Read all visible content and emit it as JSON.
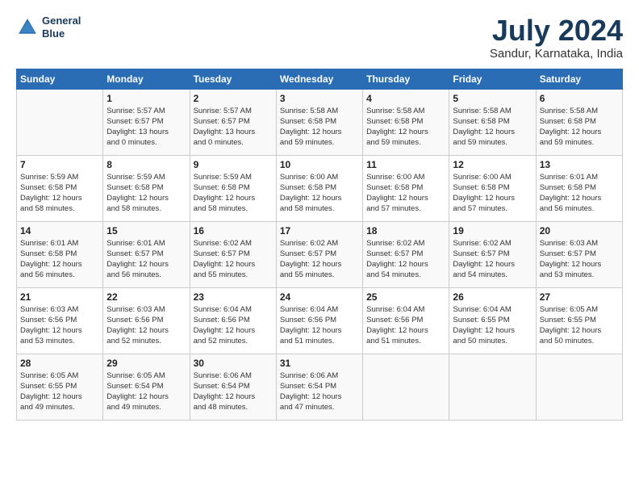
{
  "header": {
    "logo_line1": "General",
    "logo_line2": "Blue",
    "title": "July 2024",
    "subtitle": "Sandur, Karnataka, India"
  },
  "columns": [
    "Sunday",
    "Monday",
    "Tuesday",
    "Wednesday",
    "Thursday",
    "Friday",
    "Saturday"
  ],
  "weeks": [
    [
      {
        "day": "",
        "info": ""
      },
      {
        "day": "1",
        "info": "Sunrise: 5:57 AM\nSunset: 6:57 PM\nDaylight: 13 hours\nand 0 minutes."
      },
      {
        "day": "2",
        "info": "Sunrise: 5:57 AM\nSunset: 6:57 PM\nDaylight: 13 hours\nand 0 minutes."
      },
      {
        "day": "3",
        "info": "Sunrise: 5:58 AM\nSunset: 6:58 PM\nDaylight: 12 hours\nand 59 minutes."
      },
      {
        "day": "4",
        "info": "Sunrise: 5:58 AM\nSunset: 6:58 PM\nDaylight: 12 hours\nand 59 minutes."
      },
      {
        "day": "5",
        "info": "Sunrise: 5:58 AM\nSunset: 6:58 PM\nDaylight: 12 hours\nand 59 minutes."
      },
      {
        "day": "6",
        "info": "Sunrise: 5:58 AM\nSunset: 6:58 PM\nDaylight: 12 hours\nand 59 minutes."
      }
    ],
    [
      {
        "day": "7",
        "info": "Sunrise: 5:59 AM\nSunset: 6:58 PM\nDaylight: 12 hours\nand 58 minutes."
      },
      {
        "day": "8",
        "info": "Sunrise: 5:59 AM\nSunset: 6:58 PM\nDaylight: 12 hours\nand 58 minutes."
      },
      {
        "day": "9",
        "info": "Sunrise: 5:59 AM\nSunset: 6:58 PM\nDaylight: 12 hours\nand 58 minutes."
      },
      {
        "day": "10",
        "info": "Sunrise: 6:00 AM\nSunset: 6:58 PM\nDaylight: 12 hours\nand 58 minutes."
      },
      {
        "day": "11",
        "info": "Sunrise: 6:00 AM\nSunset: 6:58 PM\nDaylight: 12 hours\nand 57 minutes."
      },
      {
        "day": "12",
        "info": "Sunrise: 6:00 AM\nSunset: 6:58 PM\nDaylight: 12 hours\nand 57 minutes."
      },
      {
        "day": "13",
        "info": "Sunrise: 6:01 AM\nSunset: 6:58 PM\nDaylight: 12 hours\nand 56 minutes."
      }
    ],
    [
      {
        "day": "14",
        "info": "Sunrise: 6:01 AM\nSunset: 6:58 PM\nDaylight: 12 hours\nand 56 minutes."
      },
      {
        "day": "15",
        "info": "Sunrise: 6:01 AM\nSunset: 6:57 PM\nDaylight: 12 hours\nand 56 minutes."
      },
      {
        "day": "16",
        "info": "Sunrise: 6:02 AM\nSunset: 6:57 PM\nDaylight: 12 hours\nand 55 minutes."
      },
      {
        "day": "17",
        "info": "Sunrise: 6:02 AM\nSunset: 6:57 PM\nDaylight: 12 hours\nand 55 minutes."
      },
      {
        "day": "18",
        "info": "Sunrise: 6:02 AM\nSunset: 6:57 PM\nDaylight: 12 hours\nand 54 minutes."
      },
      {
        "day": "19",
        "info": "Sunrise: 6:02 AM\nSunset: 6:57 PM\nDaylight: 12 hours\nand 54 minutes."
      },
      {
        "day": "20",
        "info": "Sunrise: 6:03 AM\nSunset: 6:57 PM\nDaylight: 12 hours\nand 53 minutes."
      }
    ],
    [
      {
        "day": "21",
        "info": "Sunrise: 6:03 AM\nSunset: 6:56 PM\nDaylight: 12 hours\nand 53 minutes."
      },
      {
        "day": "22",
        "info": "Sunrise: 6:03 AM\nSunset: 6:56 PM\nDaylight: 12 hours\nand 52 minutes."
      },
      {
        "day": "23",
        "info": "Sunrise: 6:04 AM\nSunset: 6:56 PM\nDaylight: 12 hours\nand 52 minutes."
      },
      {
        "day": "24",
        "info": "Sunrise: 6:04 AM\nSunset: 6:56 PM\nDaylight: 12 hours\nand 51 minutes."
      },
      {
        "day": "25",
        "info": "Sunrise: 6:04 AM\nSunset: 6:56 PM\nDaylight: 12 hours\nand 51 minutes."
      },
      {
        "day": "26",
        "info": "Sunrise: 6:04 AM\nSunset: 6:55 PM\nDaylight: 12 hours\nand 50 minutes."
      },
      {
        "day": "27",
        "info": "Sunrise: 6:05 AM\nSunset: 6:55 PM\nDaylight: 12 hours\nand 50 minutes."
      }
    ],
    [
      {
        "day": "28",
        "info": "Sunrise: 6:05 AM\nSunset: 6:55 PM\nDaylight: 12 hours\nand 49 minutes."
      },
      {
        "day": "29",
        "info": "Sunrise: 6:05 AM\nSunset: 6:54 PM\nDaylight: 12 hours\nand 49 minutes."
      },
      {
        "day": "30",
        "info": "Sunrise: 6:06 AM\nSunset: 6:54 PM\nDaylight: 12 hours\nand 48 minutes."
      },
      {
        "day": "31",
        "info": "Sunrise: 6:06 AM\nSunset: 6:54 PM\nDaylight: 12 hours\nand 47 minutes."
      },
      {
        "day": "",
        "info": ""
      },
      {
        "day": "",
        "info": ""
      },
      {
        "day": "",
        "info": ""
      }
    ]
  ]
}
